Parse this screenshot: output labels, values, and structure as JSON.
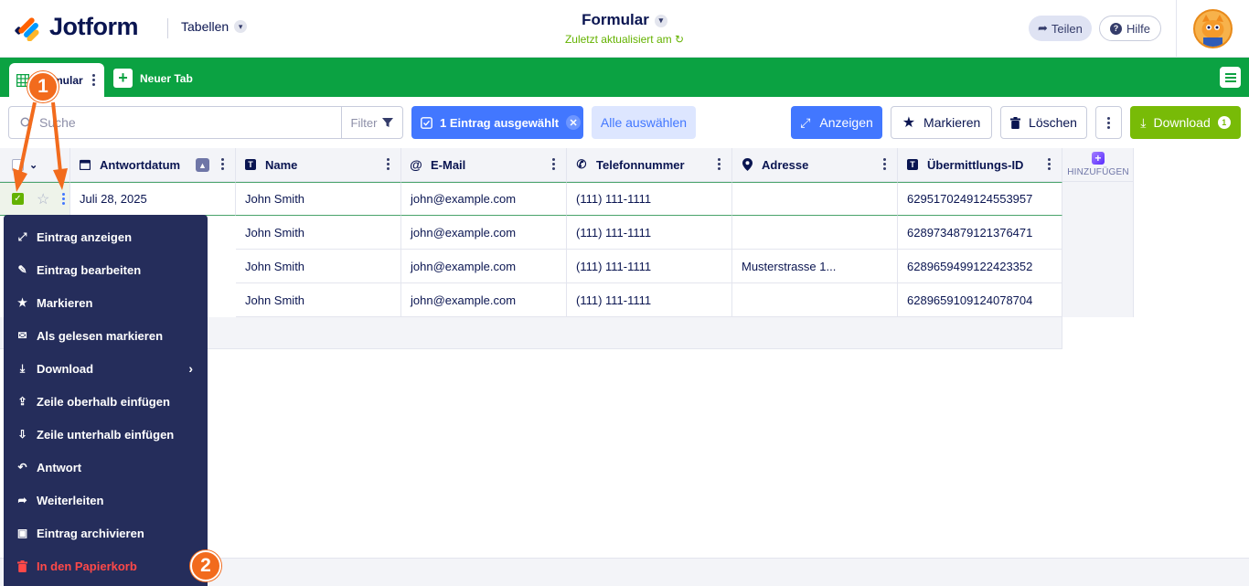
{
  "header": {
    "brand": "Jotform",
    "tables_label": "Tabellen",
    "form_title": "Formular",
    "last_updated": "Zuletzt aktualisiert am",
    "share_label": "Teilen",
    "help_label": "Hilfe"
  },
  "tabs": {
    "active_label": "mular",
    "new_tab_label": "Neuer Tab"
  },
  "toolbar": {
    "search_placeholder": "Suche",
    "filter_label": "Filter",
    "selected_label": "1 Eintrag ausgewählt",
    "select_all_label": "Alle auswählen",
    "show_label": "Anzeigen",
    "mark_label": "Markieren",
    "delete_label": "Löschen",
    "download_label": "Download",
    "download_count": "1"
  },
  "table": {
    "columns": [
      "Antwortdatum",
      "Name",
      "E-Mail",
      "Telefonnummer",
      "Adresse",
      "Übermittlungs-ID"
    ],
    "add_column_label": "HINZUFÜGEN",
    "rows": [
      {
        "date": "Juli 28, 2025",
        "name": "John Smith",
        "email": "john@example.com",
        "phone": "(111) 111-1111",
        "address": "",
        "id": "6295170249124553957"
      },
      {
        "date": "",
        "name": "John Smith",
        "email": "john@example.com",
        "phone": "(111) 111-1111",
        "address": "",
        "id": "6289734879121376471"
      },
      {
        "date": "",
        "name": "John Smith",
        "email": "john@example.com",
        "phone": "(111) 111-1111",
        "address": "Musterstrasse 1...",
        "id": "6289659499122423352"
      },
      {
        "date": "",
        "name": "John Smith",
        "email": "john@example.com",
        "phone": "(111) 111-1111",
        "address": "",
        "id": "6289659109124078704"
      }
    ]
  },
  "context_menu": {
    "items": [
      "Eintrag anzeigen",
      "Eintrag bearbeiten",
      "Markieren",
      "Als gelesen markieren",
      "Download",
      "Zeile oberhalb einfügen",
      "Zeile unterhalb einfügen",
      "Antwort",
      "Weiterleiten",
      "Eintrag archivieren",
      "In den Papierkorb"
    ]
  },
  "callouts": [
    "1",
    "2"
  ],
  "colors": {
    "brand_green": "#0ba242",
    "primary_blue": "#4277ff",
    "download_green": "#78bb07",
    "menu_bg": "#252d5b",
    "danger": "#ff4948",
    "callout_orange": "#f26b1d"
  }
}
